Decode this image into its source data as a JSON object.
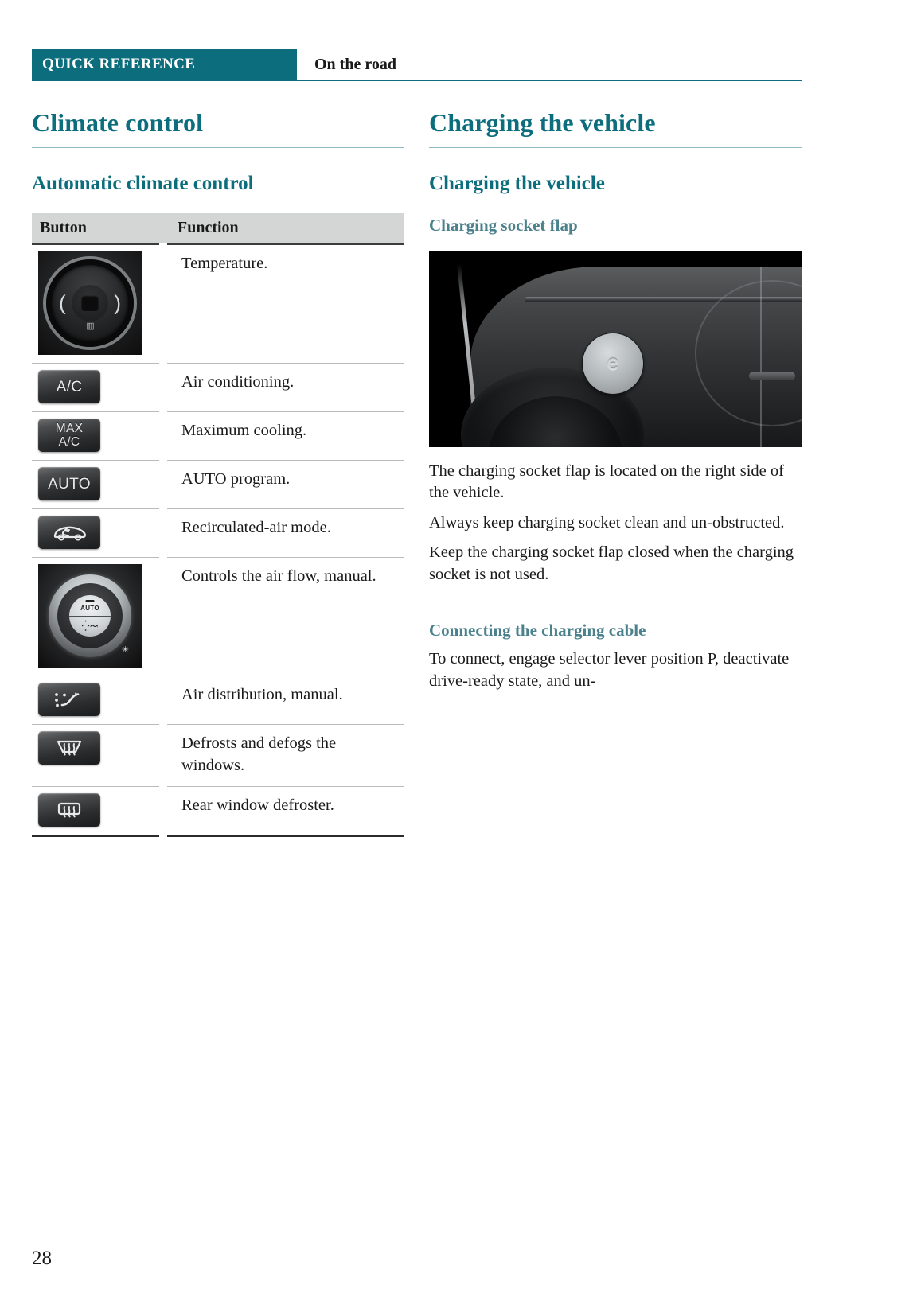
{
  "header": {
    "tag": "QUICK REFERENCE",
    "chapter": "On the road"
  },
  "left_column": {
    "chapter_title": "Climate control",
    "section_title": "Automatic climate control",
    "table": {
      "columns": [
        "Button",
        "Function"
      ],
      "rows": [
        {
          "icon": "temperature-knob-icon",
          "icon_text": "",
          "function": "Temperature."
        },
        {
          "icon": "ac-button-icon",
          "icon_text": "A/C",
          "function": "Air conditioning."
        },
        {
          "icon": "max-ac-button-icon",
          "icon_text": "MAX A/C",
          "icon_line1": "MAX",
          "icon_line2": "A/C",
          "function": "Maximum cooling."
        },
        {
          "icon": "auto-button-icon",
          "icon_text": "AUTO",
          "function": "AUTO program."
        },
        {
          "icon": "recirculated-air-button-icon",
          "icon_text": "",
          "function": "Recirculated-air mode."
        },
        {
          "icon": "fan-speed-knob-icon",
          "icon_text": "AUTO",
          "function": "Controls the air flow, manual."
        },
        {
          "icon": "air-distribution-button-icon",
          "icon_text": "",
          "function": "Air distribution, manual."
        },
        {
          "icon": "windshield-defroster-button-icon",
          "icon_text": "",
          "function": "Defrosts and defogs the windows."
        },
        {
          "icon": "rear-window-defroster-button-icon",
          "icon_text": "",
          "function": "Rear window defroster."
        }
      ]
    }
  },
  "right_column": {
    "chapter_title": "Charging the vehicle",
    "section_title": "Charging the vehicle",
    "subsection_1": "Charging socket flap",
    "photo_alt": "charging-socket-flap-photo",
    "socket_glyph": "e",
    "paragraphs": [
      "The charging socket flap is located on the right side of the vehicle.",
      "Always keep charging socket clean and un-obstructed.",
      "Keep the charging socket flap closed when the charging socket is not used."
    ],
    "subsection_2": "Connecting the charging cable",
    "paragraph_2": "To connect, engage selector lever position P, deactivate drive-ready state, and un-"
  },
  "footer": {
    "page_number": "28"
  },
  "colors": {
    "accent_teal": "#0c6d7d",
    "muted_teal": "#4b818c",
    "table_header_bg": "#d4d6d6",
    "rule_gray": "#b9bcbc"
  }
}
